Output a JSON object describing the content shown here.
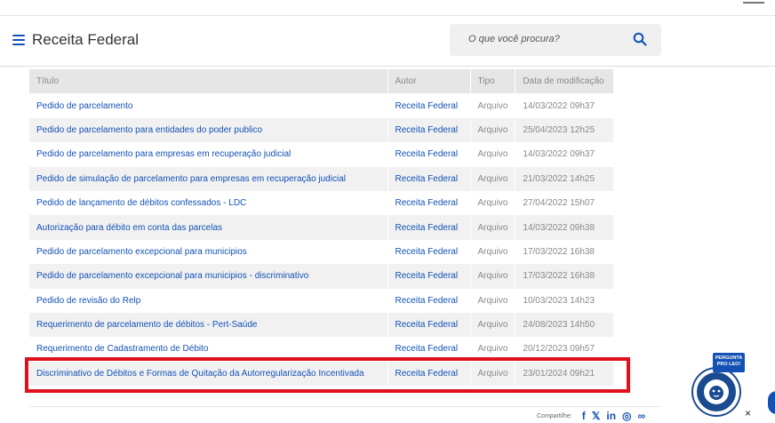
{
  "header": {
    "title": "Receita Federal",
    "search_placeholder": "O que você procura?"
  },
  "table": {
    "columns": [
      "Título",
      "Autor",
      "Tipo",
      "Data de modificação"
    ],
    "rows": [
      {
        "title": "Pedido de parcelamento",
        "author": "Receita Federal",
        "type": "Arquivo",
        "date": "14/03/2022 09h37"
      },
      {
        "title": "Pedido de parcelamento para entidades do poder publico",
        "author": "Receita Federal",
        "type": "Arquivo",
        "date": "25/04/2023 12h25"
      },
      {
        "title": "Pedido de parcelamento para empresas em recuperação judicial",
        "author": "Receita Federal",
        "type": "Arquivo",
        "date": "14/03/2022 09h37"
      },
      {
        "title": "Pedido de simulação de parcelamento para empresas em recuperação judicial",
        "author": "Receita Federal",
        "type": "Arquivo",
        "date": "21/03/2022 14h25"
      },
      {
        "title": "Pedido de lançamento de débitos confessados - LDC",
        "author": "Receita Federal",
        "type": "Arquivo",
        "date": "27/04/2022 15h07"
      },
      {
        "title": "Autorização para débito em conta das parcelas",
        "author": "Receita Federal",
        "type": "Arquivo",
        "date": "14/03/2022 09h38"
      },
      {
        "title": "Pedido de parcelamento excepcional para municipios",
        "author": "Receita Federal",
        "type": "Arquivo",
        "date": "17/03/2022 16h38"
      },
      {
        "title": "Pedido de parcelamento excepcional para municipios - discriminativo",
        "author": "Receita Federal",
        "type": "Arquivo",
        "date": "17/03/2022 16h38"
      },
      {
        "title": "Pedido de revisão do Relp",
        "author": "Receita Federal",
        "type": "Arquivo",
        "date": "10/03/2023 14h23"
      },
      {
        "title": "Requerimento de parcelamento de débitos - Pert-Saúde",
        "author": "Receita Federal",
        "type": "Arquivo",
        "date": "24/08/2023 14h50"
      },
      {
        "title": "Requerimento de Cadastramento de Débito",
        "author": "Receita Federal",
        "type": "Arquivo",
        "date": "20/12/2023 09h57"
      },
      {
        "title": "Discriminativo de Débitos e Formas de Quitação da Autorregularização Incentivada",
        "author": "Receita Federal",
        "type": "Arquivo",
        "date": "23/01/2024 09h21"
      }
    ]
  },
  "share": {
    "label": "Compartilhe:",
    "icons": [
      "facebook-icon",
      "x-icon",
      "linkedin-icon",
      "whatsapp-icon",
      "link-icon"
    ]
  },
  "assistant": {
    "badge": "PERGUNTA PRO LEO!",
    "close": "×"
  },
  "colors": {
    "link": "#1351b4",
    "highlight": "#e0101c"
  }
}
